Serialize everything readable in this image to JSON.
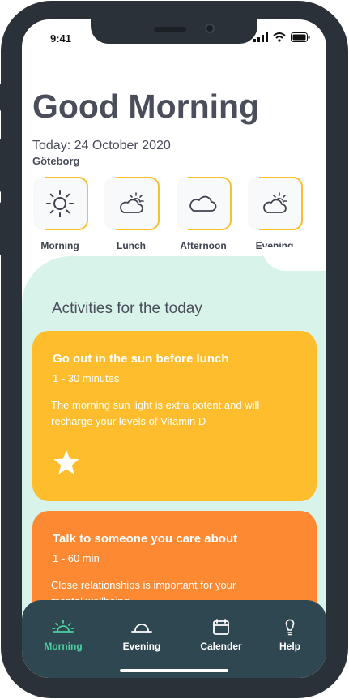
{
  "status_bar": {
    "time": "9:41"
  },
  "header": {
    "greeting": "Good Morning",
    "date": "Today: 24 October 2020",
    "location": "Göteborg"
  },
  "periods": [
    {
      "label": "Morning",
      "icon": "sun-icon"
    },
    {
      "label": "Lunch",
      "icon": "sun-behind-cloud-icon"
    },
    {
      "label": "Afternoon",
      "icon": "cloud-icon"
    },
    {
      "label": "Evening",
      "icon": "sun-behind-cloud-icon"
    }
  ],
  "activities": {
    "title": "Activities for the today",
    "items": [
      {
        "title": "Go out in the sun before lunch",
        "duration": "1 - 30 minutes",
        "description": "The morning sun light is extra potent and will recharge your levels of Vitamin D",
        "icon": "star-icon",
        "color": "#fdbd2c"
      },
      {
        "title": "Talk to someone you care about",
        "duration": "1 - 60 min",
        "description": "Close relationships is important for your mental wellbeing",
        "color": "#fd8a32"
      }
    ]
  },
  "nav": {
    "items": [
      {
        "label": "Morning",
        "icon": "sunrise-icon",
        "active": true
      },
      {
        "label": "Evening",
        "icon": "sunset-icon",
        "active": false
      },
      {
        "label": "Calender",
        "icon": "calendar-icon",
        "active": false
      },
      {
        "label": "Help",
        "icon": "lightbulb-icon",
        "active": false
      }
    ]
  },
  "colors": {
    "accent_yellow": "#fcbf2a",
    "accent_orange": "#fd8a32",
    "mint_background": "#d8f4ea",
    "nav_background": "#2f4750",
    "nav_active": "#4bd0a0",
    "heading_text": "#4a4d5a"
  }
}
